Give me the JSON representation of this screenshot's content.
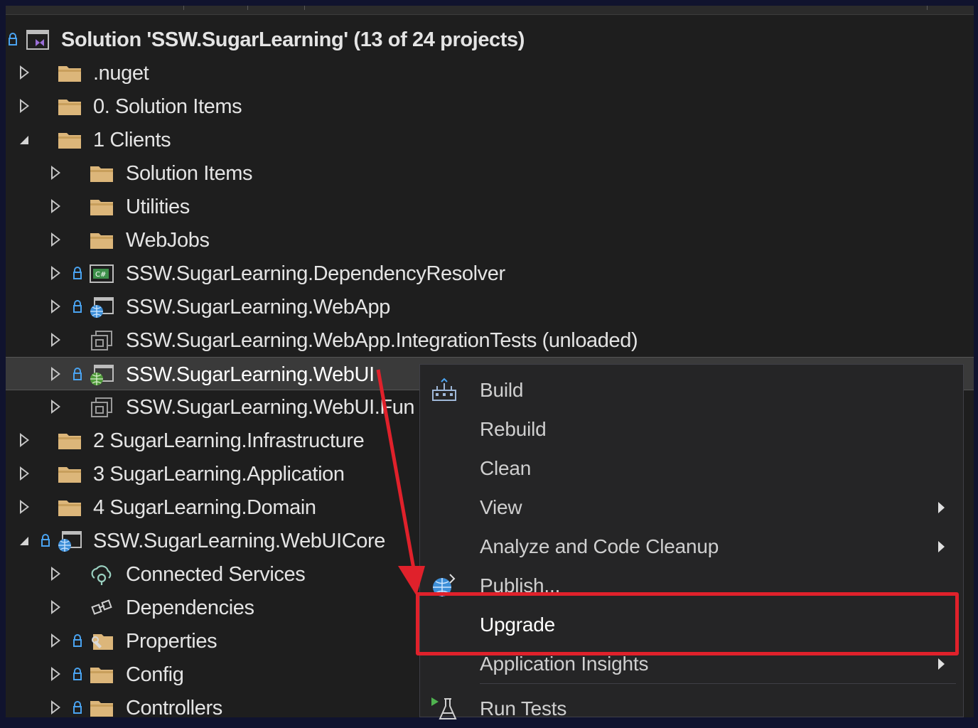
{
  "solution": {
    "title": "Solution 'SSW.SugarLearning' (13 of 24 projects)"
  },
  "tree": {
    "nuget": ".nuget",
    "solution_items": "0. Solution Items",
    "clients": "1 Clients",
    "clients_solution_items": "Solution Items",
    "utilities": "Utilities",
    "webjobs": "WebJobs",
    "dependency_resolver": "SSW.SugarLearning.DependencyResolver",
    "webapp": "SSW.SugarLearning.WebApp",
    "webapp_integration_tests": "SSW.SugarLearning.WebApp.IntegrationTests (unloaded)",
    "webui": "SSW.SugarLearning.WebUI",
    "webui_func": "SSW.SugarLearning.WebUI.Fun",
    "infrastructure": "2 SugarLearning.Infrastructure",
    "application": "3 SugarLearning.Application",
    "domain": "4 SugarLearning.Domain",
    "webuicore": "SSW.SugarLearning.WebUICore",
    "connected_services": "Connected Services",
    "dependencies": "Dependencies",
    "properties": "Properties",
    "config": "Config",
    "controllers": "Controllers"
  },
  "context_menu": {
    "build": "Build",
    "rebuild": "Rebuild",
    "clean": "Clean",
    "view": "View",
    "analyze": "Analyze and Code Cleanup",
    "publish": "Publish...",
    "upgrade": "Upgrade",
    "application_insights": "Application Insights",
    "run_tests": "Run Tests"
  },
  "colors": {
    "folder": "#dcb67a",
    "annotation_red": "#e0212b",
    "lock_blue": "#4aa3f0"
  },
  "icons": {
    "solution": "visual-studio-solution-icon",
    "folder": "folder-icon",
    "lock": "lock-icon",
    "web_project": "web-project-icon",
    "unloaded_project": "unloaded-project-icon",
    "console_project": "console-project-icon",
    "build": "build-icon",
    "publish": "publish-globe-icon",
    "run_tests": "run-tests-icon",
    "connected_services": "connected-services-icon",
    "dependencies": "dependencies-icon",
    "properties": "properties-icon"
  }
}
